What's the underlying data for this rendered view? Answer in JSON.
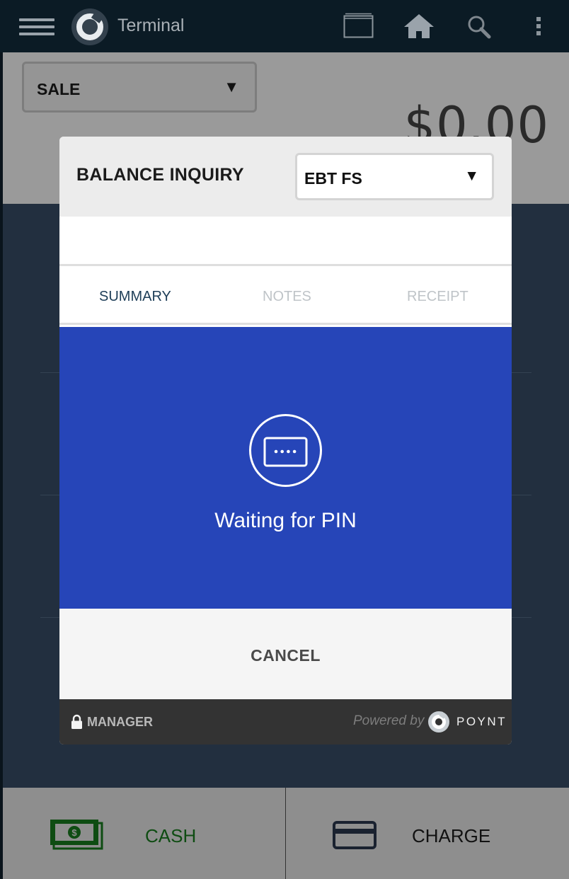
{
  "appbar": {
    "title": "Terminal",
    "icons": [
      "menu-icon",
      "poynt-logo-icon",
      "window-icon",
      "home-icon",
      "search-icon",
      "overflow-menu-icon"
    ]
  },
  "terminal": {
    "transaction_type": "SALE",
    "amount": "$0.00"
  },
  "dialog": {
    "title": "BALANCE INQUIRY",
    "card_type": "EBT FS",
    "tabs": [
      {
        "label": "SUMMARY",
        "active": true
      },
      {
        "label": "NOTES",
        "active": false
      },
      {
        "label": "RECEIPT",
        "active": false
      }
    ],
    "status_text": "Waiting for PIN",
    "cancel_label": "CANCEL",
    "footer": {
      "manager_label": "MANAGER",
      "powered_by": "Powered by",
      "brand": "POYNT"
    }
  },
  "bottombar": {
    "cash_label": "CASH",
    "charge_label": "CHARGE"
  },
  "colors": {
    "appbar": "#0b1b25",
    "pin_panel": "#2645b8",
    "cash_green": "#0e4c12",
    "footer": "#333333"
  }
}
